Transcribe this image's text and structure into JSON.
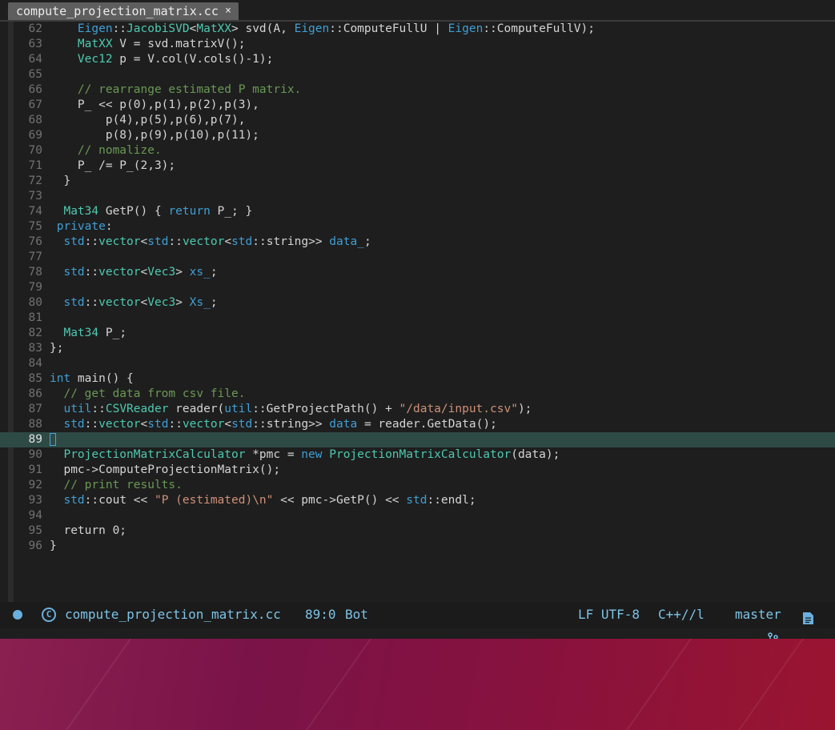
{
  "tab": {
    "title": "compute_projection_matrix.cc",
    "close": "×"
  },
  "colors": {
    "keyword": "#3f9fd5",
    "type": "#4ec9b0",
    "comment": "#6a9955",
    "string": "#ce9178",
    "text": "#d4d4d4",
    "current_line": "#2e4a45"
  },
  "editor": {
    "current_line": 89,
    "lines": [
      {
        "n": "62",
        "segs": [
          [
            "    ",
            "t"
          ],
          [
            "Eigen",
            "k"
          ],
          [
            "::",
            "t"
          ],
          [
            "JacobiSVD",
            "ty"
          ],
          [
            "<",
            "t"
          ],
          [
            "MatXX",
            "ty"
          ],
          [
            "> svd(A, ",
            "t"
          ],
          [
            "Eigen",
            "k"
          ],
          [
            "::ComputeFullU | ",
            "t"
          ],
          [
            "Eigen",
            "k"
          ],
          [
            "::ComputeFullV);",
            "t"
          ]
        ]
      },
      {
        "n": "63",
        "segs": [
          [
            "    ",
            "t"
          ],
          [
            "MatXX",
            "ty"
          ],
          [
            " V = svd.matrixV();",
            "t"
          ]
        ]
      },
      {
        "n": "64",
        "segs": [
          [
            "    ",
            "t"
          ],
          [
            "Vec12",
            "ty"
          ],
          [
            " p = V.col(V.cols()-1);",
            "t"
          ]
        ]
      },
      {
        "n": "65",
        "segs": []
      },
      {
        "n": "66",
        "segs": [
          [
            "    ",
            "t"
          ],
          [
            "// rearrange estimated P matrix.",
            "c"
          ]
        ]
      },
      {
        "n": "67",
        "segs": [
          [
            "    P_ << p(0),p(1),p(2),p(3),",
            "t"
          ]
        ]
      },
      {
        "n": "68",
        "segs": [
          [
            "        p(4),p(5),p(6),p(7),",
            "t"
          ]
        ]
      },
      {
        "n": "69",
        "segs": [
          [
            "        p(8),p(9),p(10),p(11);",
            "t"
          ]
        ]
      },
      {
        "n": "70",
        "segs": [
          [
            "    ",
            "t"
          ],
          [
            "// nomalize.",
            "c"
          ]
        ]
      },
      {
        "n": "71",
        "segs": [
          [
            "    P_ /= P_(2,3);",
            "t"
          ]
        ]
      },
      {
        "n": "72",
        "segs": [
          [
            "  }",
            "t"
          ]
        ]
      },
      {
        "n": "73",
        "segs": []
      },
      {
        "n": "74",
        "segs": [
          [
            "  ",
            "t"
          ],
          [
            "Mat34",
            "ty"
          ],
          [
            " GetP() { ",
            "t"
          ],
          [
            "return",
            "k"
          ],
          [
            " P_; }",
            "t"
          ]
        ]
      },
      {
        "n": "75",
        "segs": [
          [
            " ",
            "t"
          ],
          [
            "private",
            "k"
          ],
          [
            ":",
            "t"
          ]
        ]
      },
      {
        "n": "76",
        "segs": [
          [
            "  ",
            "t"
          ],
          [
            "std",
            "k"
          ],
          [
            "::",
            "t"
          ],
          [
            "vector",
            "ty"
          ],
          [
            "<",
            "t"
          ],
          [
            "std",
            "k"
          ],
          [
            "::",
            "t"
          ],
          [
            "vector",
            "ty"
          ],
          [
            "<",
            "t"
          ],
          [
            "std",
            "k"
          ],
          [
            "::string>> ",
            "t"
          ],
          [
            "data_",
            "v"
          ],
          [
            ";",
            "t"
          ]
        ]
      },
      {
        "n": "77",
        "segs": []
      },
      {
        "n": "78",
        "segs": [
          [
            "  ",
            "t"
          ],
          [
            "std",
            "k"
          ],
          [
            "::",
            "t"
          ],
          [
            "vector",
            "ty"
          ],
          [
            "<",
            "t"
          ],
          [
            "Vec3",
            "ty"
          ],
          [
            "> ",
            "t"
          ],
          [
            "xs_",
            "v"
          ],
          [
            ";",
            "t"
          ]
        ]
      },
      {
        "n": "79",
        "segs": []
      },
      {
        "n": "80",
        "segs": [
          [
            "  ",
            "t"
          ],
          [
            "std",
            "k"
          ],
          [
            "::",
            "t"
          ],
          [
            "vector",
            "ty"
          ],
          [
            "<",
            "t"
          ],
          [
            "Vec3",
            "ty"
          ],
          [
            "> ",
            "t"
          ],
          [
            "Xs_",
            "v"
          ],
          [
            ";",
            "t"
          ]
        ]
      },
      {
        "n": "81",
        "segs": []
      },
      {
        "n": "82",
        "segs": [
          [
            "  ",
            "t"
          ],
          [
            "Mat34",
            "ty"
          ],
          [
            " P_;",
            "t"
          ]
        ]
      },
      {
        "n": "83",
        "segs": [
          [
            "};",
            "t"
          ]
        ]
      },
      {
        "n": "84",
        "segs": []
      },
      {
        "n": "85",
        "segs": [
          [
            "int",
            "k"
          ],
          [
            " main() {",
            "t"
          ]
        ]
      },
      {
        "n": "86",
        "segs": [
          [
            "  ",
            "t"
          ],
          [
            "// get data from csv file.",
            "c"
          ]
        ]
      },
      {
        "n": "87",
        "segs": [
          [
            "  ",
            "t"
          ],
          [
            "util",
            "k"
          ],
          [
            "::",
            "t"
          ],
          [
            "CSVReader",
            "ty"
          ],
          [
            " reader(",
            "t"
          ],
          [
            "util",
            "k"
          ],
          [
            "::GetProjectPath() + ",
            "t"
          ],
          [
            "\"/data/input.csv\"",
            "s"
          ],
          [
            ");",
            "t"
          ]
        ]
      },
      {
        "n": "88",
        "segs": [
          [
            "  ",
            "t"
          ],
          [
            "std",
            "k"
          ],
          [
            "::",
            "t"
          ],
          [
            "vector",
            "ty"
          ],
          [
            "<",
            "t"
          ],
          [
            "std",
            "k"
          ],
          [
            "::",
            "t"
          ],
          [
            "vector",
            "ty"
          ],
          [
            "<",
            "t"
          ],
          [
            "std",
            "k"
          ],
          [
            "::string>> ",
            "t"
          ],
          [
            "data",
            "v"
          ],
          [
            " = reader.GetData();",
            "t"
          ]
        ]
      },
      {
        "n": "89",
        "segs": []
      },
      {
        "n": "90",
        "segs": [
          [
            "  ",
            "t"
          ],
          [
            "ProjectionMatrixCalculator",
            "ty"
          ],
          [
            " *pmc = ",
            "t"
          ],
          [
            "new",
            "k"
          ],
          [
            " ",
            "t"
          ],
          [
            "ProjectionMatrixCalculator",
            "ty"
          ],
          [
            "(data);",
            "t"
          ]
        ]
      },
      {
        "n": "91",
        "segs": [
          [
            "  pmc->ComputeProjectionMatrix();",
            "t"
          ]
        ]
      },
      {
        "n": "92",
        "segs": [
          [
            "  ",
            "t"
          ],
          [
            "// print results.",
            "c"
          ]
        ]
      },
      {
        "n": "93",
        "segs": [
          [
            "  ",
            "t"
          ],
          [
            "std",
            "k"
          ],
          [
            "::cout << ",
            "t"
          ],
          [
            "\"P (estimated)\\n\"",
            "s"
          ],
          [
            " << pmc->GetP() << ",
            "t"
          ],
          [
            "std",
            "k"
          ],
          [
            "::endl;",
            "t"
          ]
        ]
      },
      {
        "n": "94",
        "segs": []
      },
      {
        "n": "95",
        "segs": [
          [
            "  return 0;",
            "t"
          ]
        ]
      },
      {
        "n": "96",
        "segs": [
          [
            "}",
            "t"
          ]
        ]
      }
    ]
  },
  "status": {
    "filename": "compute_projection_matrix.cc",
    "position": "89:0",
    "scroll": "Bot",
    "eol_encoding": "LF UTF-8",
    "mode": "C++//l",
    "branch": "master",
    "icons": [
      "status-dot-icon",
      "cpp-file-icon",
      "git-branch-icon",
      "document-icon"
    ]
  }
}
